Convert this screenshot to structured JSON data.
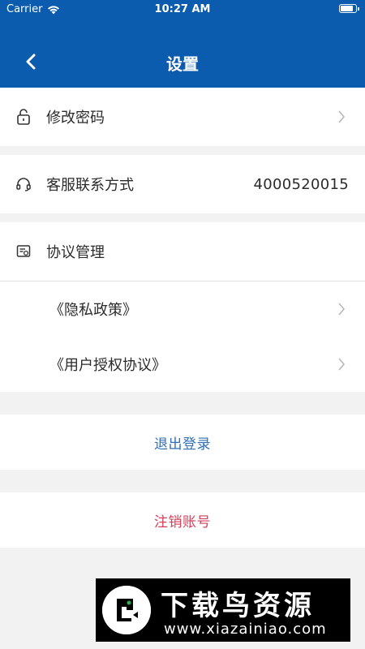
{
  "status_bar": {
    "carrier": "Carrier",
    "time": "10:27 AM",
    "battery_level": 0.9
  },
  "header": {
    "title": "设置",
    "back_icon": "chevron-left-icon"
  },
  "settings": {
    "change_password": {
      "label": "修改密码",
      "icon": "lock-icon"
    },
    "customer_service": {
      "label": "客服联系方式",
      "value": "4000520015",
      "icon": "headset-icon"
    },
    "agreements": {
      "label": "协议管理",
      "icon": "document-icon",
      "items": [
        {
          "label": "《隐私政策》"
        },
        {
          "label": "《用户授权协议》"
        }
      ]
    }
  },
  "actions": {
    "logout_label": "退出登录",
    "cancel_account_label": "注销账号"
  },
  "watermark": {
    "title": "下载鸟资源",
    "url": "www.xiazainiao.com"
  },
  "colors": {
    "header_bg": "#0b5cae",
    "logout_text": "#2e6fb8",
    "cancel_text": "#d23f5a",
    "page_bg": "#f2f2f2"
  }
}
